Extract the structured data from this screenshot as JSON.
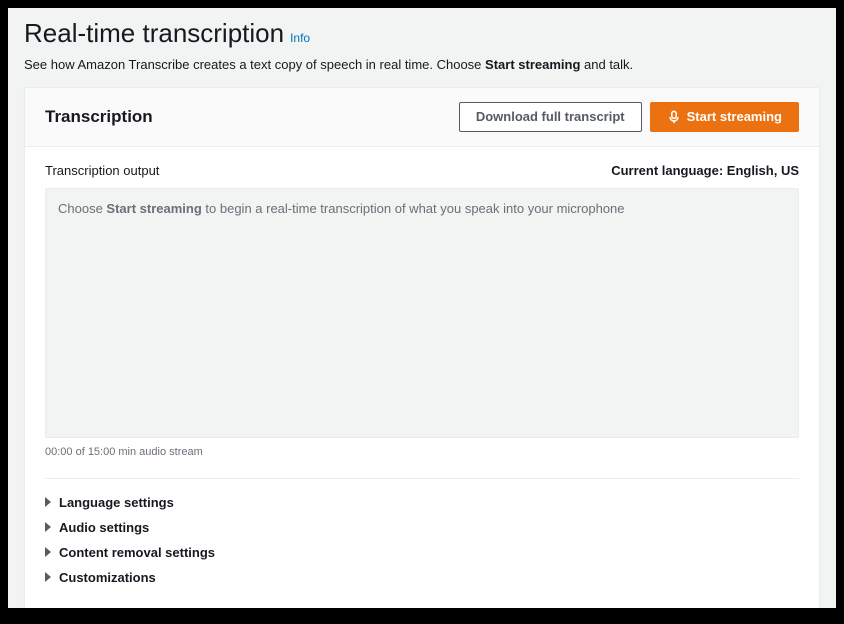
{
  "header": {
    "title": "Real-time transcription",
    "info_link": "Info",
    "description_pre": "See how Amazon Transcribe creates a text copy of speech in real time. Choose ",
    "description_bold": "Start streaming",
    "description_post": " and talk."
  },
  "panel": {
    "title": "Transcription",
    "download_btn": "Download full transcript",
    "start_btn": "Start streaming"
  },
  "output": {
    "label": "Transcription output",
    "current_language_label": "Current language: English, US",
    "placeholder_pre": "Choose ",
    "placeholder_bold": "Start streaming",
    "placeholder_post": " to begin a real-time transcription of what you speak into your microphone",
    "time_status": "00:00 of 15:00 min audio stream"
  },
  "settings": {
    "items": [
      {
        "label": "Language settings"
      },
      {
        "label": "Audio settings"
      },
      {
        "label": "Content removal settings"
      },
      {
        "label": "Customizations"
      }
    ]
  }
}
